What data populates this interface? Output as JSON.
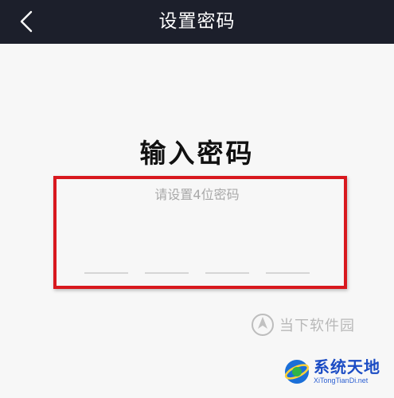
{
  "header": {
    "title": "设置密码",
    "back_icon": "chevron-left-icon",
    "bg_color": "#1c1f2b"
  },
  "main": {
    "heading": "输入密码",
    "hint": "请设置4位密码",
    "pin_slots": 4,
    "highlight_color": "#d8181e"
  },
  "watermarks": {
    "site_1": "当下软件园",
    "site_2": "系统天地",
    "site_2_url": "XiTongTianDi.net"
  }
}
